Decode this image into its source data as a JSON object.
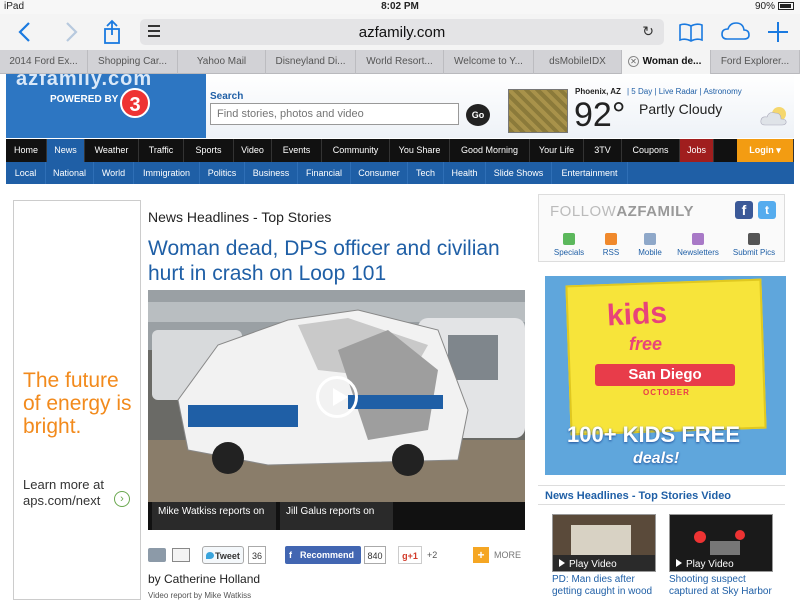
{
  "status_bar": {
    "device": "iPad",
    "time": "8:02 PM",
    "battery": "90%"
  },
  "browser": {
    "url": "azfamily.com",
    "tabs": [
      {
        "label": "2014 Ford Ex...",
        "active": false
      },
      {
        "label": "Shopping Car...",
        "active": false
      },
      {
        "label": "Yahoo Mail",
        "active": false
      },
      {
        "label": "Disneyland Di...",
        "active": false
      },
      {
        "label": "World Resort...",
        "active": false
      },
      {
        "label": "Welcome to Y...",
        "active": false
      },
      {
        "label": "dsMobileIDX",
        "active": false
      },
      {
        "label": "Woman de...",
        "active": true
      },
      {
        "label": "Ford Explorer...",
        "active": false
      }
    ]
  },
  "header": {
    "logo_text": "azfamily.com",
    "powered_by": "POWERED BY",
    "channel": "3",
    "search_label": "Search",
    "search_placeholder": "Find stories, photos and video",
    "go_label": "Go",
    "weather": {
      "location": "Phoenix, AZ",
      "links": "| 5 Day | Live Radar | Astronomy",
      "temp": "92°",
      "condition": "Partly Cloudy"
    }
  },
  "nav": {
    "main": [
      "Home",
      "News",
      "Weather",
      "Traffic",
      "Sports",
      "Video",
      "Events",
      "Community",
      "You Share",
      "Good Morning",
      "Your Life",
      "3TV",
      "Coupons",
      "Jobs",
      "Login"
    ],
    "active": "News",
    "sub": [
      "Local",
      "National",
      "World",
      "Immigration",
      "Politics",
      "Business",
      "Financial",
      "Consumer",
      "Tech",
      "Health",
      "Slide Shows",
      "Entertainment"
    ]
  },
  "ad_left": {
    "headline": "The future of energy is bright.",
    "learn": "Learn more at",
    "url": "aps.com/next"
  },
  "article": {
    "section_title": "News Headlines - Top Stories",
    "headline": "Woman dead, DPS officer and civilian hurt in crash on Loop 101",
    "captions": [
      "Mike Watkiss reports on",
      "Jill Galus reports on"
    ],
    "share": {
      "tweet": "Tweet",
      "tweet_count": "36",
      "recommend": "Recommend",
      "recommend_count": "840",
      "gplus": "g+1",
      "gplus_count": "+2",
      "more": "MORE"
    },
    "byline": "by Catherine Holland",
    "video_report": "Video report by Mike Watkiss"
  },
  "follow": {
    "title_light": "FOLLOW",
    "title_bold": "AZFAMILY",
    "links": [
      "Specials",
      "RSS",
      "Mobile",
      "Newsletters",
      "Submit Pics"
    ]
  },
  "ad_right": {
    "kids": "kids",
    "free": "free",
    "city": "San Diego",
    "month": "OCTOBER",
    "banner": "100+ KIDS FREE",
    "deals": "deals!"
  },
  "videos": {
    "section_title": "News Headlines - Top Stories Video",
    "items": [
      {
        "label": "Play Video",
        "caption": "PD: Man dies after getting caught in wood"
      },
      {
        "label": "Play Video",
        "caption": "Shooting suspect captured at Sky Harbor"
      }
    ]
  },
  "colors": {
    "brand_blue": "#1f5fa6",
    "nav_black": "#111111",
    "jobs_red": "#a01e1e",
    "login_orange": "#f39c12",
    "ad_orange": "#f28a1c"
  }
}
